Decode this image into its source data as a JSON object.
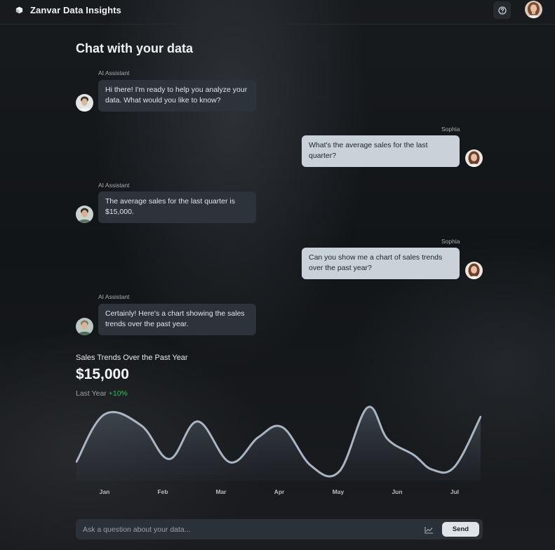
{
  "app": {
    "brand_name": "Zanvar Data Insights",
    "help_icon": "help-circle-icon"
  },
  "page": {
    "title": "Chat with your data"
  },
  "messages": [
    {
      "sender": "AI Assistant",
      "role": "assistant",
      "text": "Hi there! I'm ready to help you analyze your data. What would you like to know?"
    },
    {
      "sender": "Sophia",
      "role": "user",
      "text": "What's the average sales for the last quarter?"
    },
    {
      "sender": "AI Assistant",
      "role": "assistant",
      "text": "The average sales for the last quarter is $15,000."
    },
    {
      "sender": "Sophia",
      "role": "user",
      "text": "Can you show me a chart of sales trends over the past year?"
    },
    {
      "sender": "AI Assistant",
      "role": "assistant",
      "text": "Certainly! Here's a chart showing the sales trends over the past year."
    }
  ],
  "chart_card": {
    "title": "Sales Trends Over the Past Year",
    "value": "$15,000",
    "period_label": "Last Year",
    "change": "+10%",
    "change_color": "#22c55e"
  },
  "chart_data": {
    "type": "area",
    "title": "Sales Trends Over the Past Year",
    "categories": [
      "Jan",
      "Feb",
      "Mar",
      "Apr",
      "May",
      "Jun",
      "Jul"
    ],
    "x": [
      0,
      0.07,
      0.16,
      0.23,
      0.3,
      0.38,
      0.45,
      0.51,
      0.58,
      0.65,
      0.72,
      0.77,
      0.835,
      0.88,
      0.935,
      1.0
    ],
    "y": [
      0.18,
      0.9,
      0.73,
      0.22,
      0.79,
      0.17,
      0.55,
      0.7,
      0.12,
      0.03,
      1.0,
      0.52,
      0.28,
      0.06,
      0.1,
      0.86
    ],
    "xlabel": "",
    "ylabel": "",
    "grid": false,
    "line_color": "#a9b5c2"
  },
  "composer": {
    "placeholder": "Ask a question about your data...",
    "chart_icon": "line-chart-icon",
    "send_label": "Send"
  }
}
